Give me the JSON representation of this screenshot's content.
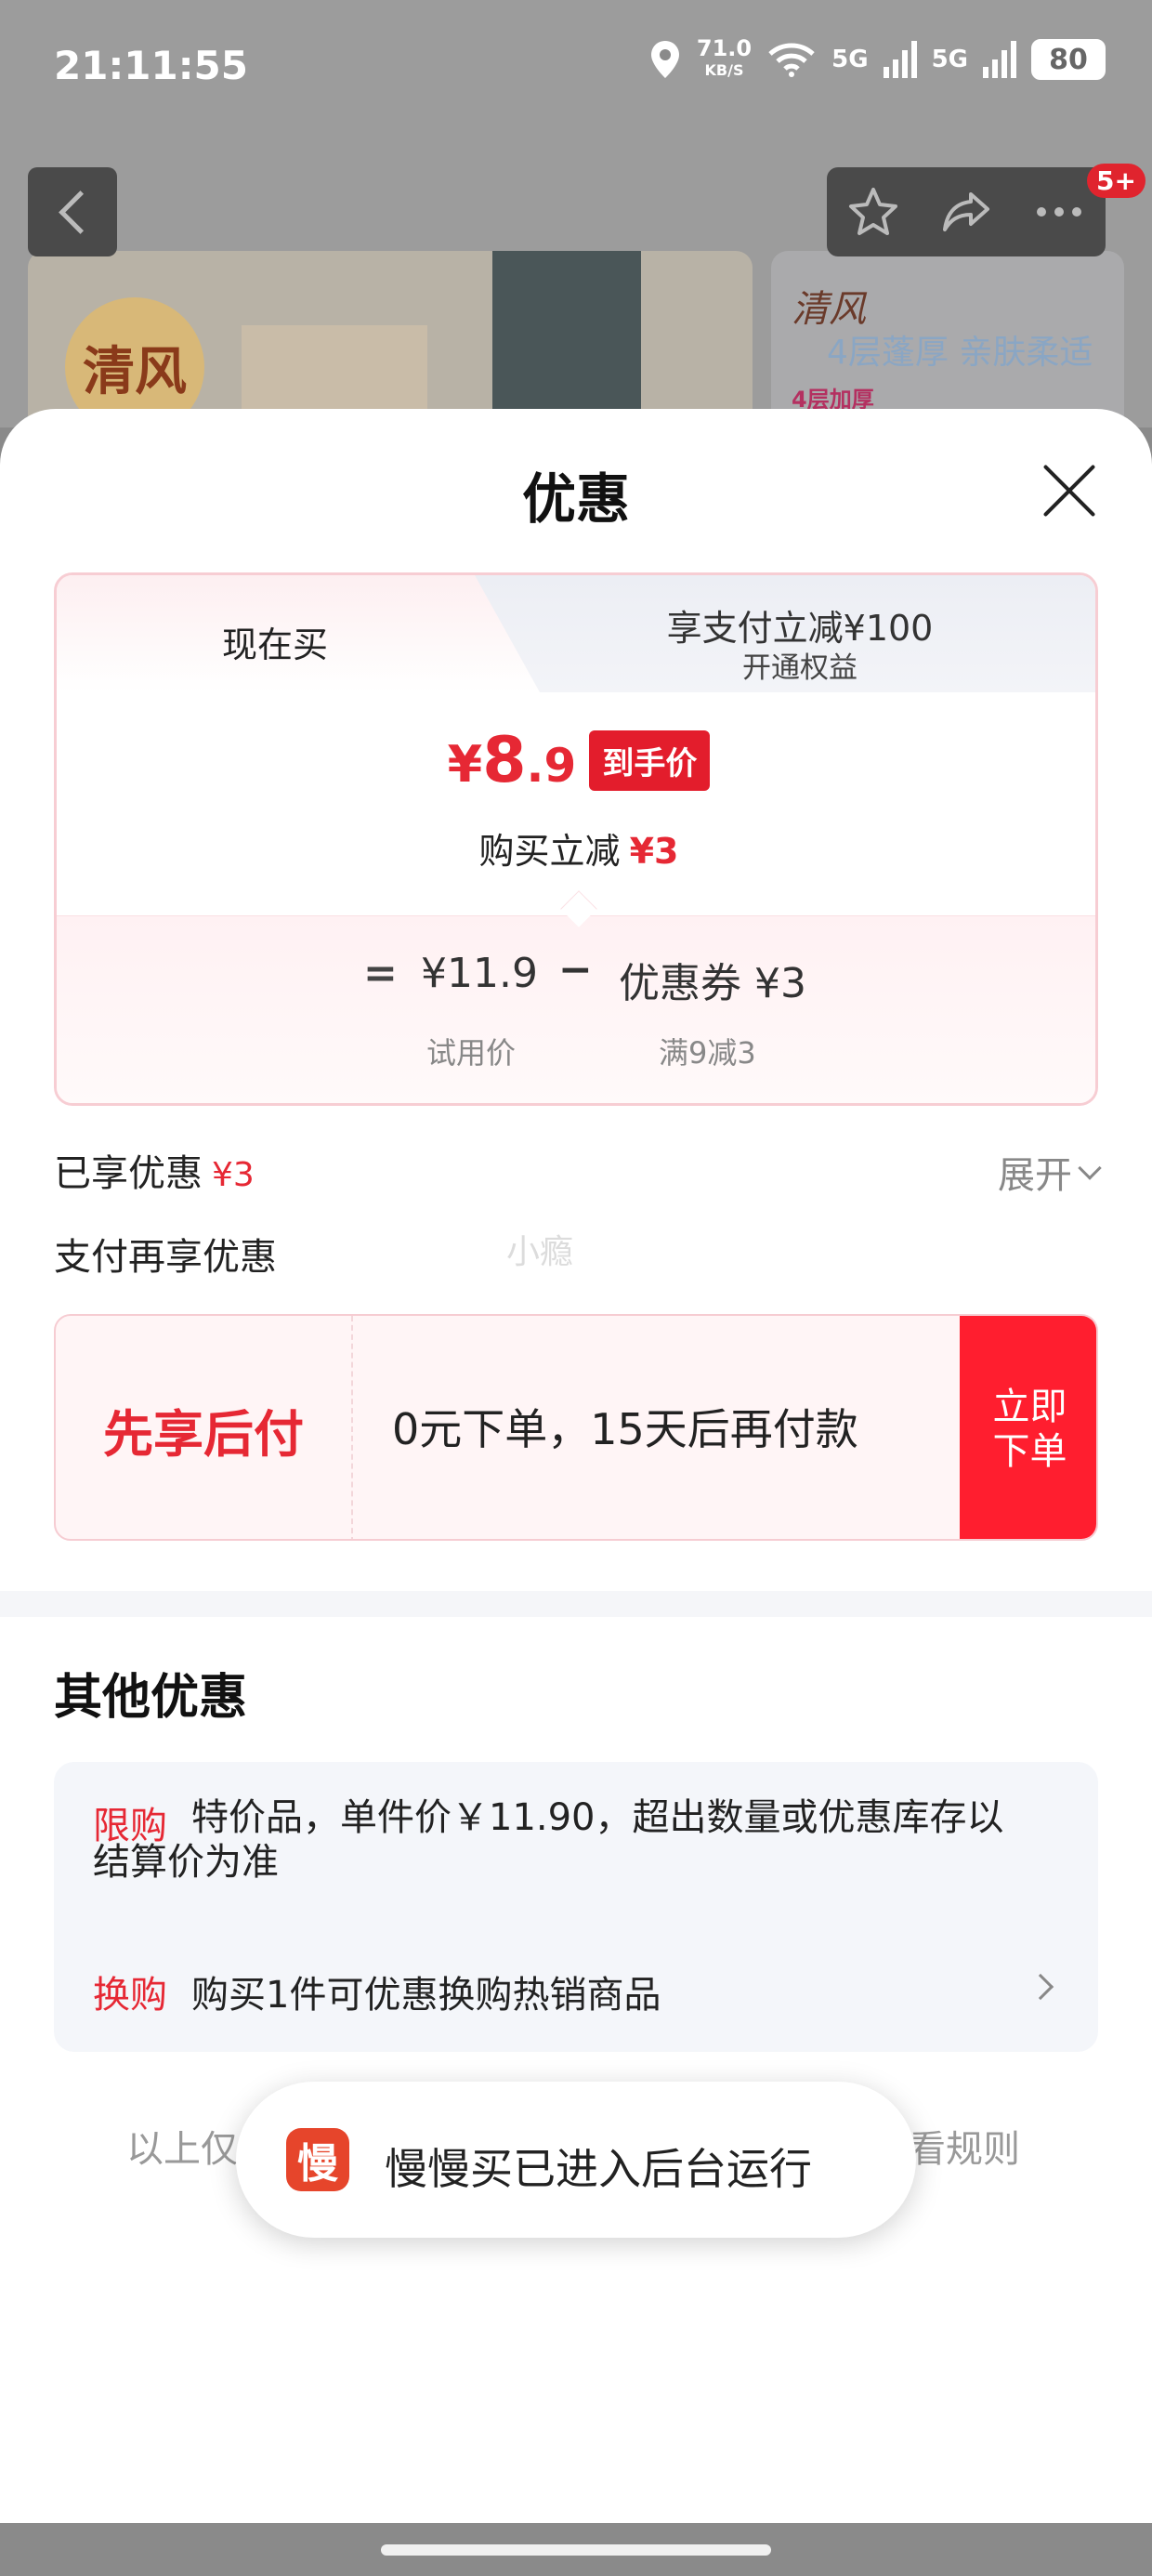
{
  "status_bar": {
    "time": "21:11:55",
    "net_speed": "71.0",
    "net_unit": "KB/S",
    "signal1": "5G",
    "signal2": "5G",
    "battery": "80"
  },
  "top_actions": {
    "badge": "5+"
  },
  "background_product": {
    "brand": "清风",
    "tagline": "4层蓬厚 亲肤柔适",
    "tag": "4层加厚"
  },
  "sheet": {
    "title": "优惠"
  },
  "tabs": {
    "active": "现在买",
    "inactive_main": "享支付立减¥100",
    "inactive_sub": "开通权益"
  },
  "price": {
    "symbol": "¥",
    "integer": "8",
    "decimal": ".9",
    "badge": "到手价",
    "reduce_label": "购买立减",
    "reduce_amount": "¥3"
  },
  "breakdown": {
    "equals": "=",
    "trial_price": "¥11.9",
    "minus": "−",
    "coupon": "优惠券 ¥3",
    "trial_label": "试用价",
    "coupon_label": "满9减3"
  },
  "enjoyed": {
    "label": "已享优惠",
    "amount": "¥3",
    "expand": "展开"
  },
  "pay_more": "支付再享优惠",
  "watermark": "小瘾",
  "bnpl": {
    "title": "先享后付",
    "desc": "0元下单，15天后再付款",
    "button": "立即下单"
  },
  "other": {
    "title": "其他优惠",
    "limit_tag": "限购",
    "limit_text": "特价品，单件价￥11.90，超出数量或优惠库存以结算价为准",
    "swap_tag": "换购",
    "swap_text": "购买1件可优惠换购热销商品"
  },
  "rules": {
    "left": "以上仅",
    "right": "看规则"
  },
  "toast": {
    "icon": "慢",
    "text": "慢慢买已进入后台运行"
  },
  "colors": {
    "accent": "#e62834",
    "button": "#ff1e2f"
  }
}
